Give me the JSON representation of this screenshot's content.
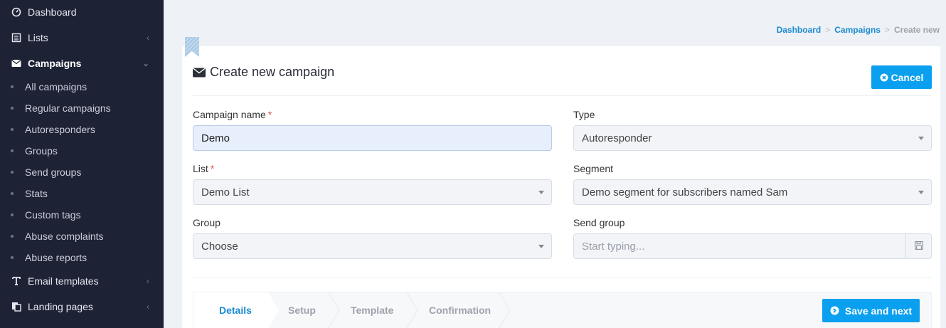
{
  "sidebar": {
    "items": [
      {
        "label": "Dashboard",
        "icon": "dashboard-icon"
      },
      {
        "label": "Lists",
        "icon": "list-icon"
      },
      {
        "label": "Campaigns",
        "icon": "envelope-icon"
      },
      {
        "label": "Email templates",
        "icon": "text-icon"
      },
      {
        "label": "Landing pages",
        "icon": "copy-icon"
      }
    ],
    "campaign_sub": [
      "All campaigns",
      "Regular campaigns",
      "Autoresponders",
      "Groups",
      "Send groups",
      "Stats",
      "Custom tags",
      "Abuse complaints",
      "Abuse reports"
    ]
  },
  "breadcrumb": {
    "home": "Dashboard",
    "section": "Campaigns",
    "current": "Create new",
    "separator": ">"
  },
  "card": {
    "title": "Create new campaign",
    "cancel_label": "Cancel"
  },
  "form": {
    "campaign_name": {
      "label": "Campaign name",
      "required": "*",
      "value": "Demo"
    },
    "type": {
      "label": "Type",
      "value": "Autoresponder"
    },
    "list": {
      "label": "List",
      "required": "*",
      "value": "Demo List"
    },
    "segment": {
      "label": "Segment",
      "value": "Demo segment for subscribers named Sam"
    },
    "group": {
      "label": "Group",
      "value": "Choose"
    },
    "send_group": {
      "label": "Send group",
      "placeholder": "Start typing..."
    }
  },
  "wizard": {
    "steps": [
      "Details",
      "Setup",
      "Template",
      "Confirmation"
    ],
    "active_step": "Details",
    "save_label": "Save and next"
  },
  "colors": {
    "sidebar_bg": "#1e2235",
    "accent": "#0ba0ef",
    "link": "#1a8bd0"
  }
}
